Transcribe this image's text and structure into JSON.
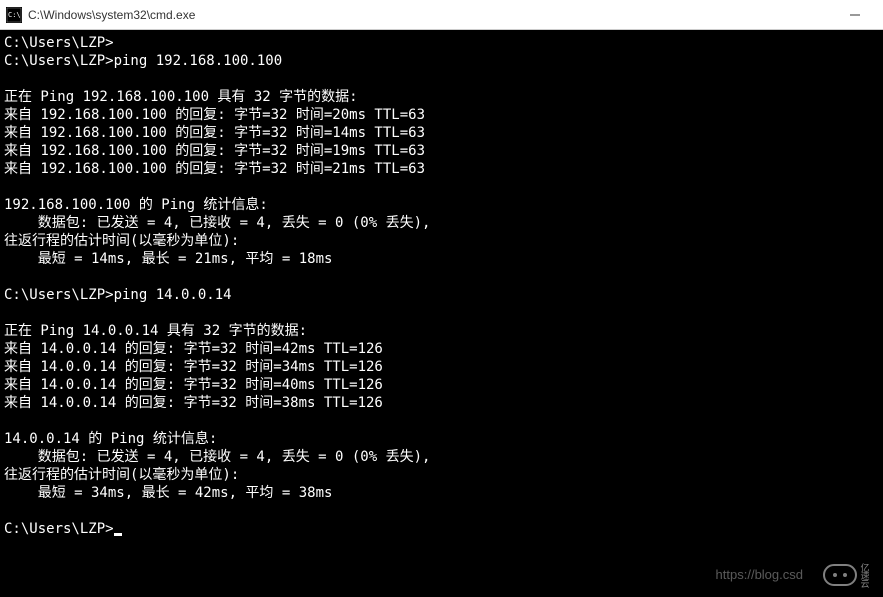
{
  "titlebar": {
    "title": "C:\\Windows\\system32\\cmd.exe"
  },
  "terminal": {
    "lines": [
      "C:\\Users\\LZP>",
      "C:\\Users\\LZP>ping 192.168.100.100",
      "",
      "正在 Ping 192.168.100.100 具有 32 字节的数据:",
      "来自 192.168.100.100 的回复: 字节=32 时间=20ms TTL=63",
      "来自 192.168.100.100 的回复: 字节=32 时间=14ms TTL=63",
      "来自 192.168.100.100 的回复: 字节=32 时间=19ms TTL=63",
      "来自 192.168.100.100 的回复: 字节=32 时间=21ms TTL=63",
      "",
      "192.168.100.100 的 Ping 统计信息:",
      "    数据包: 已发送 = 4, 已接收 = 4, 丢失 = 0 (0% 丢失),",
      "往返行程的估计时间(以毫秒为单位):",
      "    最短 = 14ms, 最长 = 21ms, 平均 = 18ms",
      "",
      "C:\\Users\\LZP>ping 14.0.0.14",
      "",
      "正在 Ping 14.0.0.14 具有 32 字节的数据:",
      "来自 14.0.0.14 的回复: 字节=32 时间=42ms TTL=126",
      "来自 14.0.0.14 的回复: 字节=32 时间=34ms TTL=126",
      "来自 14.0.0.14 的回复: 字节=32 时间=40ms TTL=126",
      "来自 14.0.0.14 的回复: 字节=32 时间=38ms TTL=126",
      "",
      "14.0.0.14 的 Ping 统计信息:",
      "    数据包: 已发送 = 4, 已接收 = 4, 丢失 = 0 (0% 丢失),",
      "往返行程的估计时间(以毫秒为单位):",
      "    最短 = 34ms, 最长 = 42ms, 平均 = 38ms",
      "",
      "C:\\Users\\LZP>"
    ],
    "prompt_last": "C:\\Users\\LZP>"
  },
  "watermark": {
    "text": "https://blog.csd",
    "logo_text": "亿速云"
  }
}
